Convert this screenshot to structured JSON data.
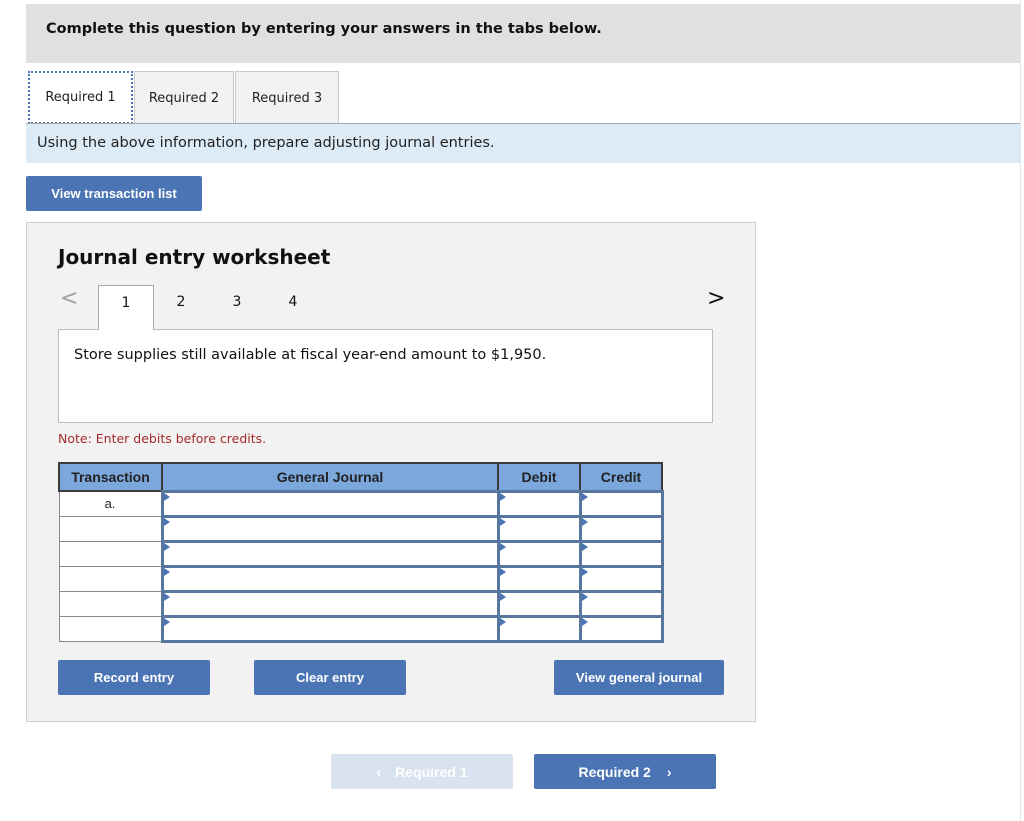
{
  "instruction": "Complete this question by entering your answers in the tabs below.",
  "tabs": [
    {
      "label": "Required 1",
      "active": true
    },
    {
      "label": "Required 2",
      "active": false
    },
    {
      "label": "Required 3",
      "active": false
    }
  ],
  "prompt": "Using the above information, prepare adjusting journal entries.",
  "view_transaction_list_label": "View transaction list",
  "worksheet": {
    "title": "Journal entry worksheet",
    "prev_icon": "chevron-left-icon",
    "next_icon": "chevron-right-icon",
    "steps": [
      "1",
      "2",
      "3",
      "4"
    ],
    "active_step": "1",
    "description": "Store supplies still available at fiscal year-end amount to $1,950.",
    "note": "Note: Enter debits before credits.",
    "table": {
      "headers": [
        "Transaction",
        "General Journal",
        "Debit",
        "Credit"
      ],
      "rows": [
        {
          "transaction": "a.",
          "account": "",
          "debit": "",
          "credit": ""
        },
        {
          "transaction": "",
          "account": "",
          "debit": "",
          "credit": ""
        },
        {
          "transaction": "",
          "account": "",
          "debit": "",
          "credit": ""
        },
        {
          "transaction": "",
          "account": "",
          "debit": "",
          "credit": ""
        },
        {
          "transaction": "",
          "account": "",
          "debit": "",
          "credit": ""
        },
        {
          "transaction": "",
          "account": "",
          "debit": "",
          "credit": ""
        }
      ]
    },
    "record_entry_label": "Record entry",
    "clear_entry_label": "Clear entry",
    "view_general_journal_label": "View general journal"
  },
  "bottom_nav": {
    "prev_label": "Required 1",
    "prev_icon": "‹",
    "prev_disabled": true,
    "next_label": "Required 2",
    "next_icon": "›"
  },
  "colors": {
    "accent": "#4a74b4",
    "header_fill": "#7ba7dc",
    "prompt_bg": "#ddebf7",
    "note": "#a52a2a"
  }
}
